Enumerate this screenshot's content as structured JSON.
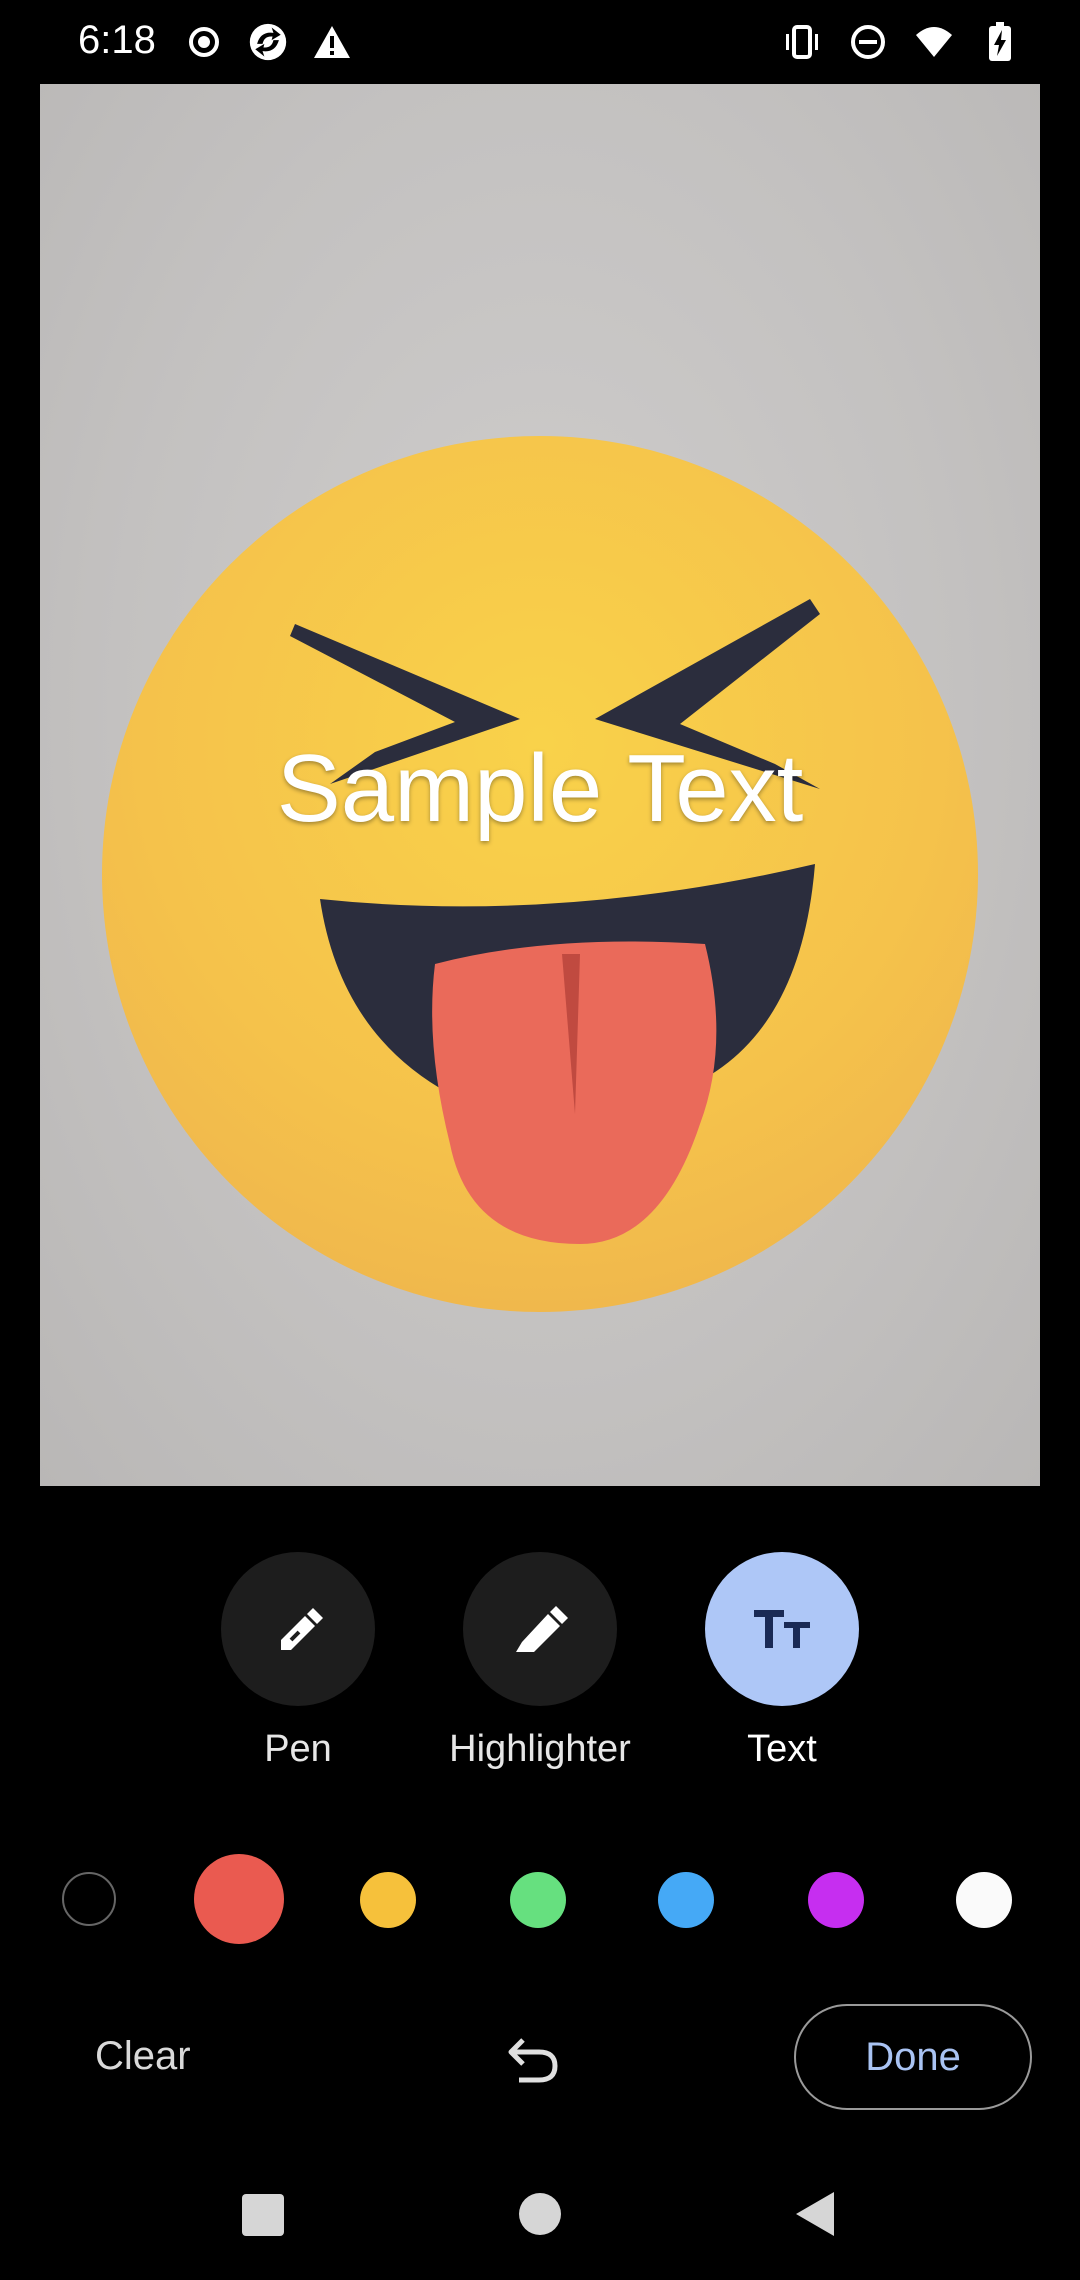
{
  "status_bar": {
    "time": "6:18",
    "left_icons": [
      "record-icon",
      "sync-app-icon",
      "warning-icon"
    ],
    "right_icons": [
      "vibrate-icon",
      "do-not-disturb-icon",
      "wifi-icon",
      "battery-charging-icon"
    ]
  },
  "canvas": {
    "overlay_text": "Sample Text",
    "image_subject": "squinting-face-with-tongue-emoji"
  },
  "tools": [
    {
      "label": "Pen",
      "icon": "pen-icon",
      "selected": false
    },
    {
      "label": "Highlighter",
      "icon": "highlighter-icon",
      "selected": false
    },
    {
      "label": "Text",
      "icon": "text-size-icon",
      "selected": true
    }
  ],
  "palette": {
    "colors": [
      "#000000",
      "#ea5a50",
      "#f6c13b",
      "#66e07f",
      "#45a9f6",
      "#c62ef0",
      "#fafafa"
    ],
    "selected_index": 1
  },
  "actions": {
    "clear_label": "Clear",
    "undo_icon": "undo-icon",
    "done_label": "Done"
  },
  "nav_bar": {
    "buttons": [
      "recents-square-icon",
      "home-circle-icon",
      "back-triangle-icon"
    ]
  }
}
